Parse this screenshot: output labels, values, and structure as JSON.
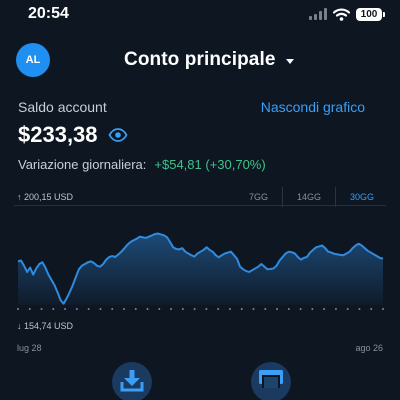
{
  "status_bar": {
    "time": "20:54",
    "battery": "100"
  },
  "header": {
    "avatar_initials": "AL",
    "account_title": "Conto principale"
  },
  "balance": {
    "label": "Saldo account",
    "hide_chart_label": "Nascondi grafico",
    "value": "$233,38",
    "change_label": "Variazione giornaliera:",
    "change_value": "+$54,81 (+30,70%)"
  },
  "chart": {
    "max_label": "↑ 200,15 USD",
    "min_label": "↓ 154,74 USD",
    "ranges": [
      "7GG",
      "14GG",
      "30GG"
    ],
    "active_range": "30GG",
    "start_date": "lug 28",
    "end_date": "ago 26"
  },
  "colors": {
    "background": "#0e1622",
    "accent": "#3a9ff5",
    "positive": "#3fc28a",
    "line": "#2f8be0"
  },
  "chart_data": {
    "type": "area",
    "ylim": [
      154.74,
      200.15
    ],
    "x_start": "lug 28",
    "x_end": "ago 26",
    "values": [
      179.5,
      180,
      177,
      173.5,
      176,
      172,
      175.5,
      178,
      179,
      176,
      172,
      169,
      166,
      162,
      157.5,
      155.5,
      158.5,
      162,
      166,
      170.5,
      175,
      177,
      178,
      179,
      179.5,
      178.5,
      177,
      176.5,
      178,
      180.5,
      182,
      182.5,
      182,
      183.5,
      185,
      187,
      189,
      190.5,
      191.5,
      192.3,
      193.5,
      193.2,
      192.8,
      193.5,
      194.2,
      195,
      195.3,
      194.8,
      194.3,
      193.2,
      190.5,
      187.5,
      186.5,
      186.3,
      187,
      185,
      184,
      183,
      182.2,
      184,
      185,
      186,
      187.5,
      186,
      185,
      183,
      181.8,
      183,
      184,
      184.5,
      185,
      183,
      181,
      176.5,
      175,
      174,
      173.5,
      174.5,
      175.5,
      176.5,
      178,
      176.5,
      175,
      175.2,
      175.5,
      177,
      180,
      182,
      184,
      185,
      184.7,
      184,
      182,
      180.5,
      181.5,
      182,
      184.5,
      186,
      187.5,
      188,
      188.5,
      187,
      185,
      184.5,
      183.8,
      183.5,
      183.2,
      183,
      184,
      185,
      187,
      188.5,
      189.5,
      188.5,
      187,
      185.5,
      184.5,
      183.5,
      182.5,
      181.5,
      181
    ]
  },
  "actions": {
    "deposit_icon": "download-tray-icon",
    "transfer_icon": "card-transfer-icon"
  }
}
